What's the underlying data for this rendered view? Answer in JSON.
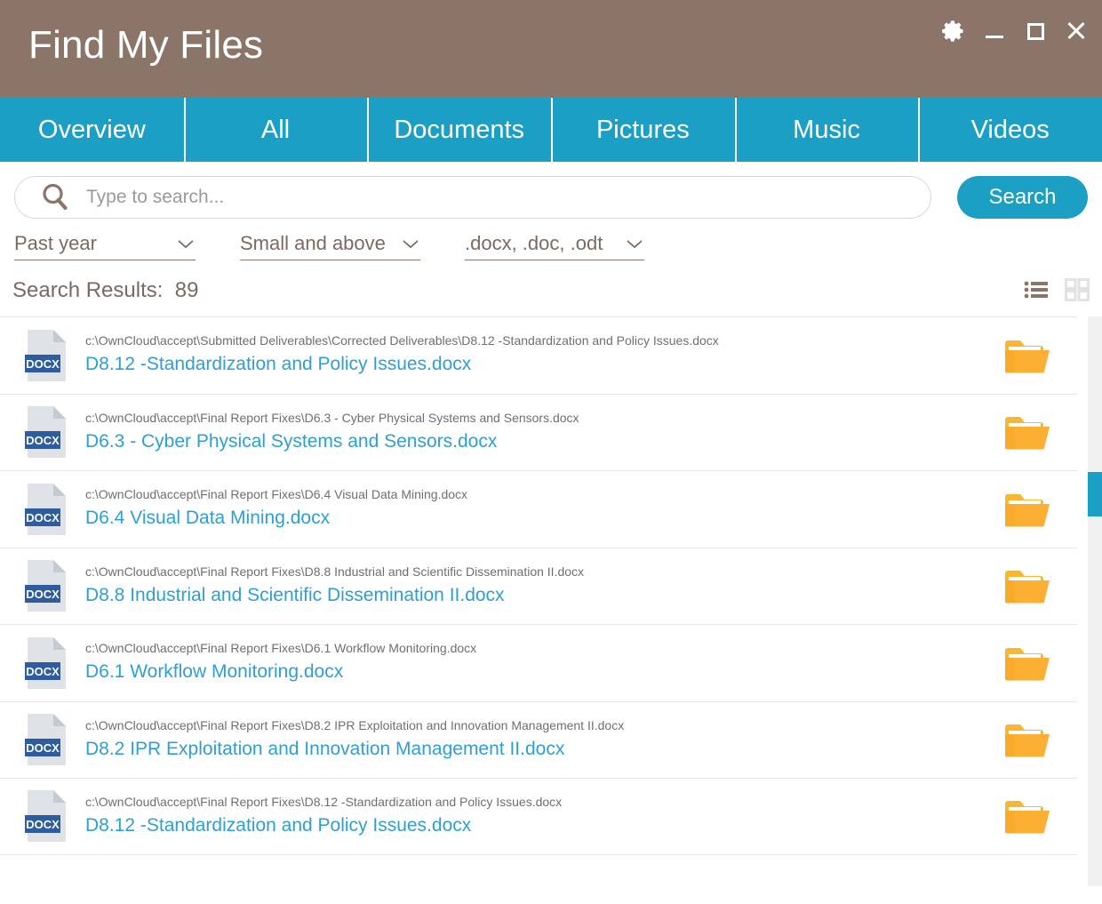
{
  "window": {
    "title": "Find My Files",
    "brand_color": "#8b7568",
    "accent_color": "#1c9fc4",
    "controls": [
      {
        "name": "settings-button",
        "icon": "gear-icon"
      },
      {
        "name": "minimize-button",
        "icon": "minimize-icon"
      },
      {
        "name": "maximize-button",
        "icon": "maximize-icon"
      },
      {
        "name": "close-button",
        "icon": "close-icon"
      }
    ]
  },
  "tabs": {
    "active": "Documents",
    "items": [
      {
        "label": "Overview"
      },
      {
        "label": "All"
      },
      {
        "label": "Documents"
      },
      {
        "label": "Pictures"
      },
      {
        "label": "Music"
      },
      {
        "label": "Videos"
      }
    ]
  },
  "search": {
    "icon": "search-icon",
    "value": "",
    "placeholder": "Type to search...",
    "button_label": "Search"
  },
  "filters": [
    {
      "name": "date-filter",
      "value": "Past year",
      "icon": "chevron-down-icon"
    },
    {
      "name": "size-filter",
      "value": "Small and above",
      "icon": "chevron-down-icon"
    },
    {
      "name": "filetype-filter",
      "value": ".docx, .doc, .odt",
      "icon": "chevron-down-icon"
    }
  ],
  "results": {
    "header_label": "Search Results:",
    "count": "89",
    "view_modes": [
      {
        "name": "list-view-button",
        "icon": "list-icon",
        "active": true
      },
      {
        "name": "grid-view-button",
        "icon": "grid-icon",
        "active": false
      }
    ],
    "file_badge": "DOCX",
    "folder_icon": "folder-icon",
    "items": [
      {
        "path": "c:\\OwnCloud\\accept\\Submitted Deliverables\\Corrected Deliverables\\D8.12 -Standardization and Policy Issues.docx",
        "name": "D8.12 -Standardization and Policy Issues.docx",
        "type": "DOCX"
      },
      {
        "path": "c:\\OwnCloud\\accept\\Final Report Fixes\\D6.3 - Cyber Physical Systems and Sensors.docx",
        "name": "D6.3 - Cyber Physical Systems and Sensors.docx",
        "type": "DOCX"
      },
      {
        "path": "c:\\OwnCloud\\accept\\Final Report Fixes\\D6.4 Visual Data Mining.docx",
        "name": "D6.4 Visual Data Mining.docx",
        "type": "DOCX"
      },
      {
        "path": "c:\\OwnCloud\\accept\\Final Report Fixes\\D8.8 Industrial and Scientific Dissemination II.docx",
        "name": "D8.8 Industrial and Scientific Dissemination II.docx",
        "type": "DOCX"
      },
      {
        "path": "c:\\OwnCloud\\accept\\Final Report Fixes\\D6.1 Workflow Monitoring.docx",
        "name": "D6.1 Workflow Monitoring.docx",
        "type": "DOCX"
      },
      {
        "path": "c:\\OwnCloud\\accept\\Final Report Fixes\\D8.2 IPR Exploitation and Innovation Management II.docx",
        "name": "D8.2 IPR Exploitation and Innovation Management II.docx",
        "type": "DOCX"
      },
      {
        "path": "c:\\OwnCloud\\accept\\Final Report Fixes\\D8.12 -Standardization and Policy Issues.docx",
        "name": "D8.12 -Standardization and Policy Issues.docx",
        "type": "DOCX"
      }
    ]
  }
}
